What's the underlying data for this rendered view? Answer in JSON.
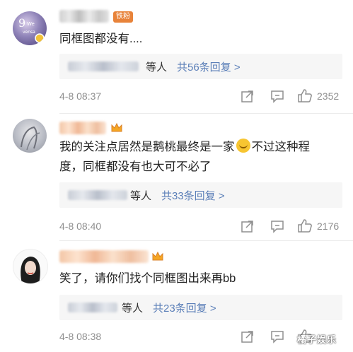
{
  "comments": [
    {
      "badge": "铁粉",
      "text_lines": [
        "同框图都没有...."
      ],
      "reply": {
        "who": "等人",
        "count": "共56条回复 >"
      },
      "time": "4-8 08:37",
      "likes": "2352"
    },
    {
      "text_lines": [
        "我的关注点居然是鹅桃最终是一家",
        "不过这种程",
        "度，同框都没有也大可不必了"
      ],
      "emoji": "laughing-tears-emoji",
      "reply": {
        "who": "等人",
        "count": "共33条回复 >"
      },
      "time": "4-8 08:40",
      "likes": "2176"
    },
    {
      "text_lines": [
        "笑了，请你们找个同框图出来再bb"
      ],
      "reply": {
        "who": "等人",
        "count": "共23条回复 >"
      },
      "time": "4-8 08:38",
      "likes": ""
    }
  ],
  "watermark": "橘子娱乐",
  "colors": {
    "reply_link": "#5b7fb8",
    "badge": "#e8833a",
    "meta": "#8f8f8f"
  }
}
